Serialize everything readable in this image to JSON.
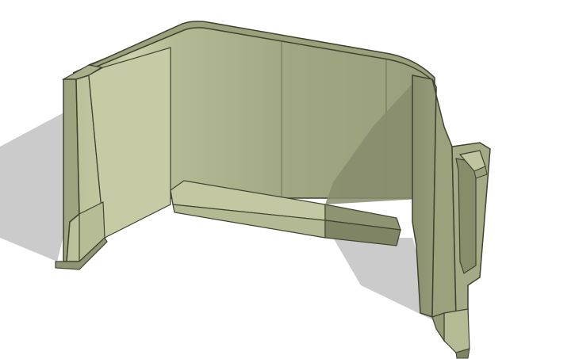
{
  "viewport": {
    "background": "#ffffff",
    "subject": "3d-model-render"
  },
  "colors": {
    "model_base": "#b9bf99",
    "model_light": "#cdd2ad",
    "model_mid": "#a6ac86",
    "model_dark": "#8b9170",
    "model_shadow_face": "#7e8464",
    "edge": "#3e4330",
    "ground_shadow": "#cbcbcb"
  }
}
